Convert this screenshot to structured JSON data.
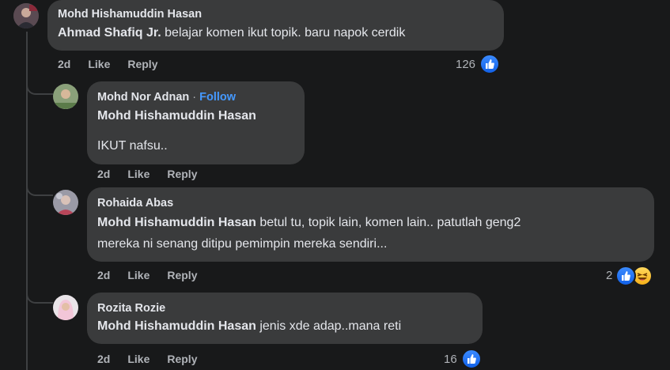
{
  "colors": {
    "background": "#18191a",
    "bubble": "#3a3b3c",
    "text_primary": "#e4e6eb",
    "text_secondary": "#b0b3b8",
    "link_blue": "#4599ff",
    "like_blue": "#1877f2"
  },
  "comments": [
    {
      "author": "Mohd Hishamuddin Hasan",
      "mention": "Ahmad Shafiq Jr.",
      "text": " belajar komen ikut topik. baru napok cerdik",
      "time": "2d",
      "like_label": "Like",
      "reply_label": "Reply",
      "reaction_count": "126",
      "reaction_icons": [
        "like-icon"
      ]
    },
    {
      "author": "Mohd Nor Adnan",
      "separator": "·",
      "follow_label": "Follow",
      "mention": "Mohd Hishamuddin Hasan",
      "text": "IKUT nafsu..",
      "time": "2d",
      "like_label": "Like",
      "reply_label": "Reply"
    },
    {
      "author": "Rohaida Abas",
      "mention": "Mohd Hishamuddin Hasan",
      "text_line1": " betul tu, topik lain, komen lain.. patutlah geng2",
      "text_line2": "mereka ni senang ditipu pemimpin mereka sendiri...",
      "time": "2d",
      "like_label": "Like",
      "reply_label": "Reply",
      "reaction_count": "2",
      "reaction_icons": [
        "like-icon",
        "haha-icon"
      ]
    },
    {
      "author": "Rozita Rozie",
      "mention": "Mohd Hishamuddin Hasan",
      "text": " jenis xde adap..mana reti",
      "time": "2d",
      "like_label": "Like",
      "reply_label": "Reply",
      "reaction_count": "16",
      "reaction_icons": [
        "like-icon"
      ]
    }
  ]
}
